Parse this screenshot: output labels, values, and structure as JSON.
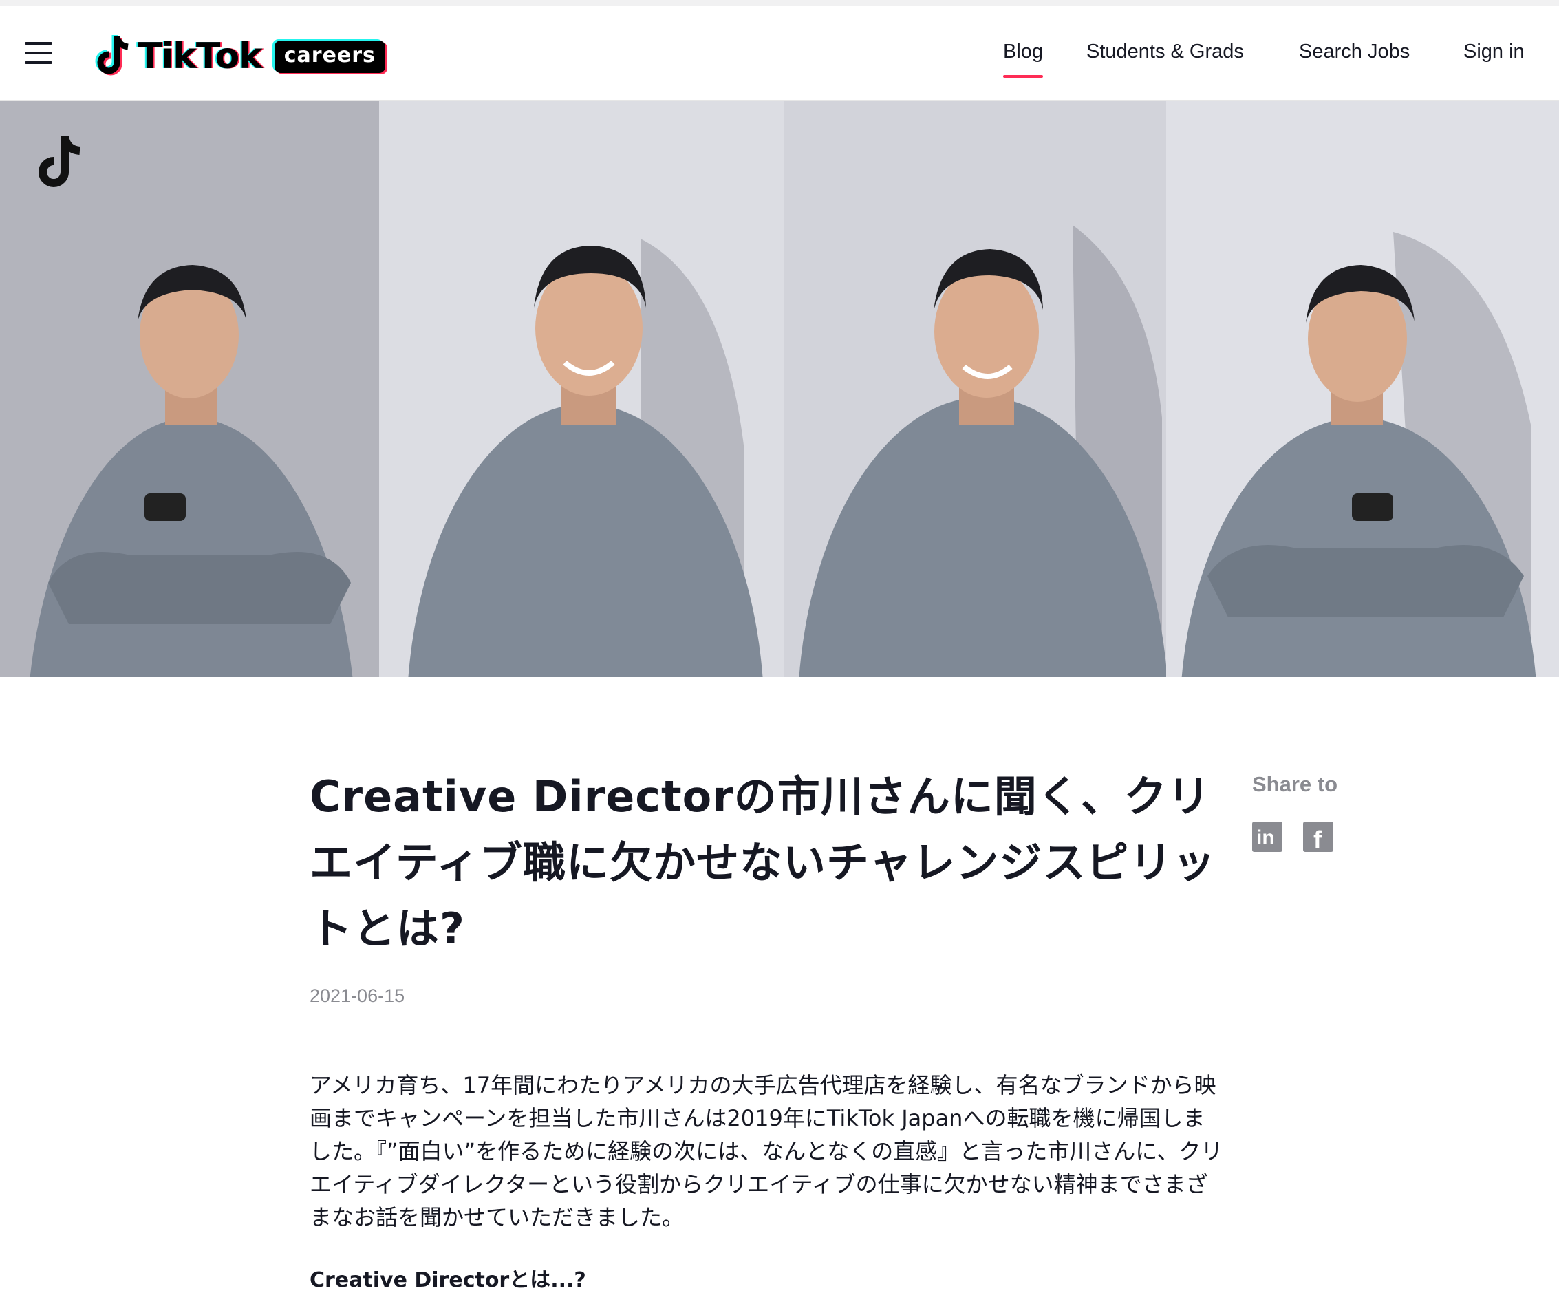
{
  "header": {
    "logo_word": "TikTok",
    "logo_badge": "careers",
    "nav": [
      {
        "label": "Blog",
        "active": true
      },
      {
        "label": "Students & Grads"
      },
      {
        "label": "Search Jobs"
      },
      {
        "label": "Sign in"
      }
    ]
  },
  "article": {
    "title": "Creative Directorの市川さんに聞く、クリエイティブ職に欠かせないチャレンジスピリットとは?",
    "date": "2021-06-15",
    "lead": "アメリカ育ち、17年間にわたりアメリカの大手広告代理店を経験し、有名なブランドから映画までキャンペーンを担当した市川さんは2019年にTikTok Japanへの転職を機に帰国しました。『”面白い”を作るために経験の次には、なんとなくの直感』と言った市川さんに、クリエイティブダイレクターという役割からクリエイティブの仕事に欠かせない精神までさまざまなお話を聞かせていただきました。",
    "subhead": "Creative Directorとは...?"
  },
  "share": {
    "label": "Share to",
    "icons": [
      "linkedin-icon",
      "facebook-icon"
    ]
  },
  "colors": {
    "accent": "#fe2c55",
    "cyan": "#25f4ee",
    "text": "#161823",
    "muted": "#8a8b91"
  }
}
